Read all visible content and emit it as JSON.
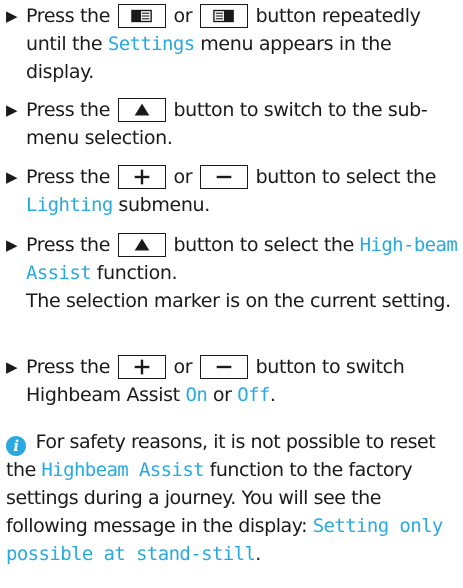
{
  "bullet_char": "▶",
  "info_char": "i",
  "colors": {
    "accent": "#2aa9df",
    "text": "#1a1a1a"
  },
  "steps": [
    {
      "t1": "Press the ",
      "key1": "display-left-button-icon",
      "t2": " or ",
      "key2": "display-right-button-icon",
      "t3": " button repeatedly until the ",
      "kw1": "Settings",
      "t4": " menu appears in the display."
    },
    {
      "t1": "Press the ",
      "key1": "up-arrow-button-icon",
      "t2": " button to switch to the sub-menu selection."
    },
    {
      "t1": "Press the ",
      "key1": "plus-button-icon",
      "t2": " or ",
      "key2": "minus-button-icon",
      "t3": " button to select the ",
      "kw1": "Lighting",
      "t4": " submenu."
    },
    {
      "t1": "Press the ",
      "key1": "up-arrow-button-icon",
      "t2": " button to select the ",
      "kw1": "High-beam Assist",
      "t3": " function.",
      "t4": "The selection marker is on the current setting."
    },
    {
      "t1": "Press the ",
      "key1": "plus-button-icon",
      "t2": " or ",
      "key2": "minus-button-icon",
      "t3": " button to switch Highbeam Assist ",
      "kw1": "On",
      "t4": " or ",
      "kw2": "Off",
      "t5": "."
    }
  ],
  "note": {
    "t1": " For safety reasons, it is not possible to reset the ",
    "kw1": "Highbeam Assist",
    "t2": " function to the factory settings during a journey. You will see the following message in the display: ",
    "msg": "Setting only possible at stand-still",
    "t3": "."
  }
}
